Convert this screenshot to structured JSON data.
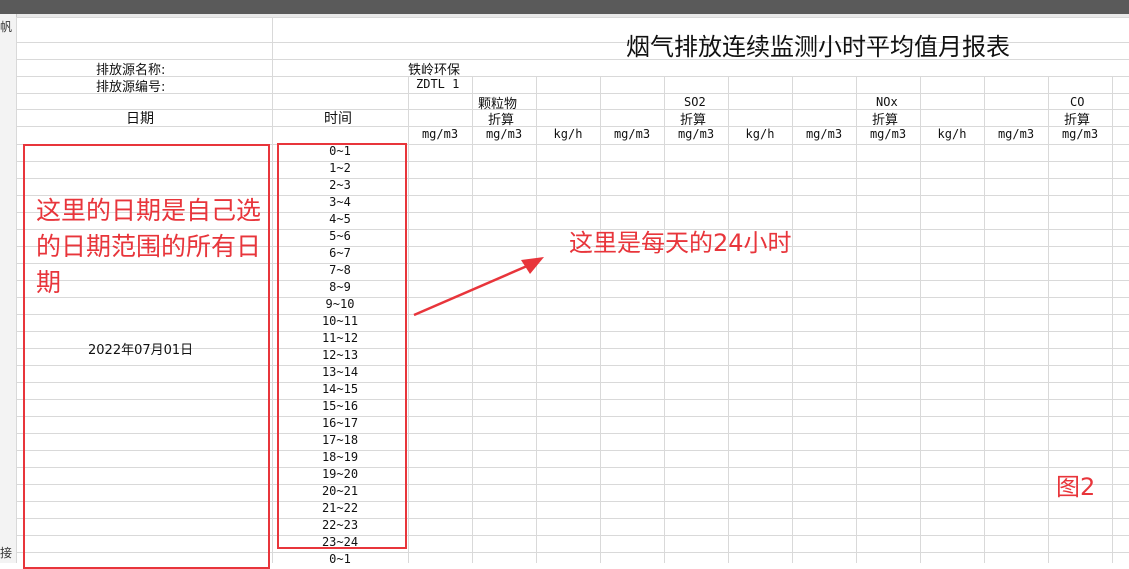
{
  "left_gutter": {
    "row_label_top": "帆",
    "row_label_bottom": "接"
  },
  "report": {
    "title": "烟气排放连续监测小时平均值月报表",
    "source_name_label": "排放源名称:",
    "source_name_value": "铁岭环保",
    "source_code_label": "排放源编号:",
    "source_code_value": "ZDTL 1",
    "date_header": "日期",
    "time_header": "时间",
    "groups": [
      {
        "name": "颗粒物",
        "sub": "折算"
      },
      {
        "name": "SO2",
        "sub": "折算"
      },
      {
        "name": "NOx",
        "sub": "折算"
      },
      {
        "name": "CO",
        "sub": "折算"
      }
    ],
    "unit_cols": [
      "mg/m3",
      "mg/m3",
      "kg/h",
      "mg/m3",
      "mg/m3",
      "kg/h",
      "mg/m3",
      "mg/m3",
      "kg/h",
      "mg/m3",
      "mg/m3"
    ],
    "date_value": "2022年07月01日",
    "hours": [
      "0~1",
      "1~2",
      "2~3",
      "3~4",
      "4~5",
      "5~6",
      "6~7",
      "7~8",
      "8~9",
      "9~10",
      "10~11",
      "11~12",
      "12~13",
      "13~14",
      "14~15",
      "15~16",
      "16~17",
      "17~18",
      "18~19",
      "19~20",
      "20~21",
      "21~22",
      "22~23",
      "23~24",
      "0~1"
    ]
  },
  "annotations": {
    "left_note": "这里的日期是自己选的日期范围的所有日期",
    "right_note": "这里是每天的24小时",
    "figure_label": "图2",
    "color": "#e8353b"
  }
}
